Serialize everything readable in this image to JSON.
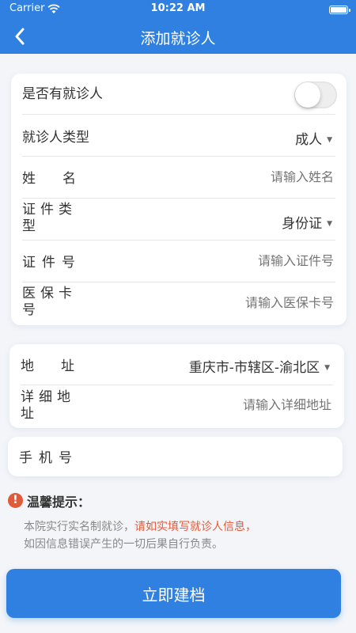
{
  "status_bar": {
    "carrier": "Carrier",
    "time": "10:22 AM",
    "battery_level": 1.0
  },
  "nav": {
    "title": "添加就诊人",
    "back_icon": "chevron-left-icon"
  },
  "form": {
    "has_patient": {
      "label": "是否有就诊人",
      "enabled": false
    },
    "patient_type": {
      "label": "就诊人类型",
      "value": "成人"
    },
    "name": {
      "label": "姓名",
      "placeholder": "请输入姓名"
    },
    "id_type": {
      "label": "证件类型",
      "value": "身份证"
    },
    "id_number": {
      "label": "证件号",
      "placeholder": "请输入证件号"
    },
    "insurance_card": {
      "label": "医保卡号",
      "placeholder": "请输入医保卡号"
    },
    "address": {
      "label": "地址",
      "value": "重庆市-市辖区-渝北区"
    },
    "address_detail": {
      "label": "详细地址",
      "placeholder": "请输入详细地址"
    },
    "phone": {
      "label": "手机号",
      "placeholder": ""
    }
  },
  "tips": {
    "title": "温馨提示：",
    "text_prefix": "本院实行实名制就诊，",
    "text_highlight": "请如实填写就诊人信息，",
    "text_suffix": "如因信息错误产生的一切后果自行负责。"
  },
  "submit_label": "立即建档",
  "colors": {
    "primary": "#2f80e0",
    "warning": "#e05a3c",
    "placeholder": "#b8b8b8"
  }
}
